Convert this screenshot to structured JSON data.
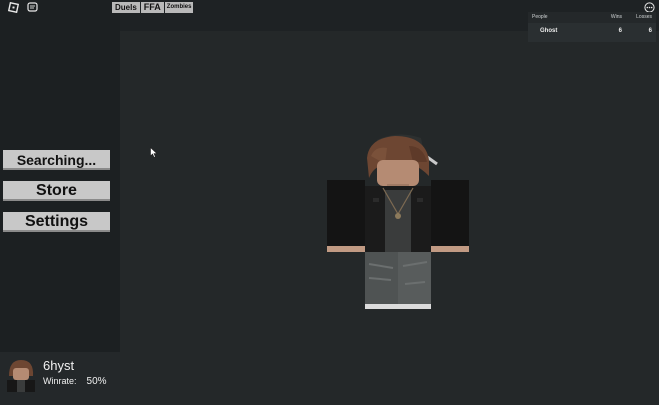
{
  "topbar": {
    "icons": [
      "roblox-icon",
      "chat-icon",
      "more-menu-icon"
    ]
  },
  "mode_tabs": [
    {
      "label": "Duels"
    },
    {
      "label": "FFA"
    },
    {
      "label": "Zombies"
    }
  ],
  "leaderboard": {
    "headers": {
      "name": "People",
      "wins": "Wins",
      "losses": "Losses"
    },
    "rows": [
      {
        "name": "Ghost",
        "wins": "6",
        "losses": "6"
      }
    ]
  },
  "menu": {
    "searching_label": "Searching...",
    "store_label": "Store",
    "settings_label": "Settings"
  },
  "profile": {
    "username": "6hyst",
    "winrate_label": "Winrate:",
    "winrate_value": "50%"
  },
  "colors": {
    "background": "#1e2224",
    "viewport": "#242829",
    "button": "#c8c8c8"
  }
}
